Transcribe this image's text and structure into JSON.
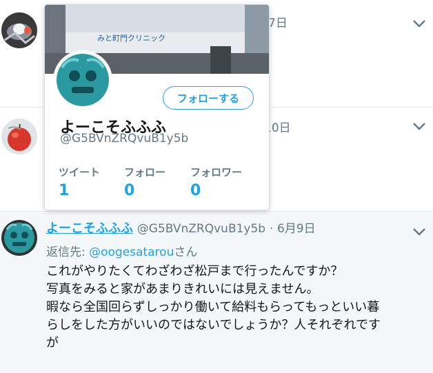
{
  "tweets": [
    {
      "date_fragment": "7日"
    },
    {
      "date_fragment": "10日"
    },
    {
      "display_name": "よーこそふふふ",
      "handle": "@G5BVnZRQvuB1y5b",
      "separator": "·",
      "date": "6月9日",
      "reply_prefix": "返信先: ",
      "reply_mention": "@oogesatarou",
      "reply_suffix": "さん",
      "body_lines": [
        "これがやりたくてわざわざ松戸まで行ったんですか？",
        "写真をみると家があまりきれいには見えません。",
        "暇なら全国回らずしっかり働いて給料もらってもっといい暮",
        "らしをした方がいいのではないでしょうか？人それぞれです",
        "が"
      ]
    }
  ],
  "hover_card": {
    "banner_sign_text": "みと町門クリニック",
    "follow_button": "フォローする",
    "display_name": "よーこそふふふ",
    "handle": "@G5BVnZRQvuB1y5b",
    "stats": [
      {
        "label": "ツイート",
        "value": "1"
      },
      {
        "label": "フォロー",
        "value": "0"
      },
      {
        "label": "フォロワー",
        "value": "0"
      }
    ]
  },
  "colors": {
    "accent": "#1da1f2",
    "secondary_text": "#657786",
    "highlight_bg": "#f5f8fa"
  },
  "icons": [
    "chevron-down-icon",
    "avatar"
  ]
}
